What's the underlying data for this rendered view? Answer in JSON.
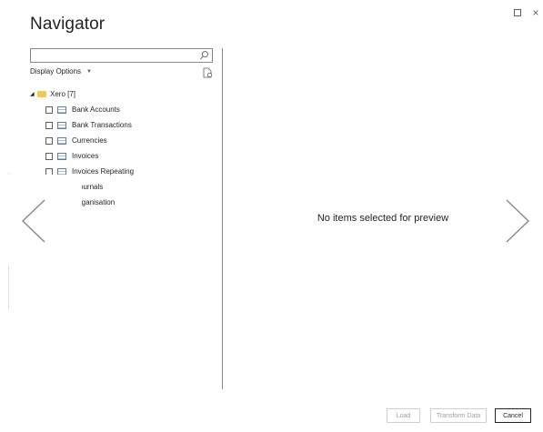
{
  "window": {
    "title": "Navigator",
    "controls": {
      "maximize": "□",
      "close": "×"
    }
  },
  "navigator": {
    "search": {
      "value": "",
      "placeholder": ""
    },
    "display_options_label": "Display Options",
    "tree": {
      "root_label": "Xero [7]",
      "items": [
        "Bank Accounts",
        "Bank Transactions",
        "Currencies",
        "Invoices",
        "Invoices Repeating",
        "ournals",
        "rganisation"
      ]
    }
  },
  "preview": {
    "message": "No items selected for preview"
  },
  "footer": {
    "load_label": "Load",
    "transform_label": "Transform Data",
    "cancel_label": "Cancel"
  },
  "colors": {
    "folder": "#f2c94c",
    "table_icon": "#5b7fb1",
    "disabled_text": "#a19f9d",
    "text": "#252423"
  }
}
